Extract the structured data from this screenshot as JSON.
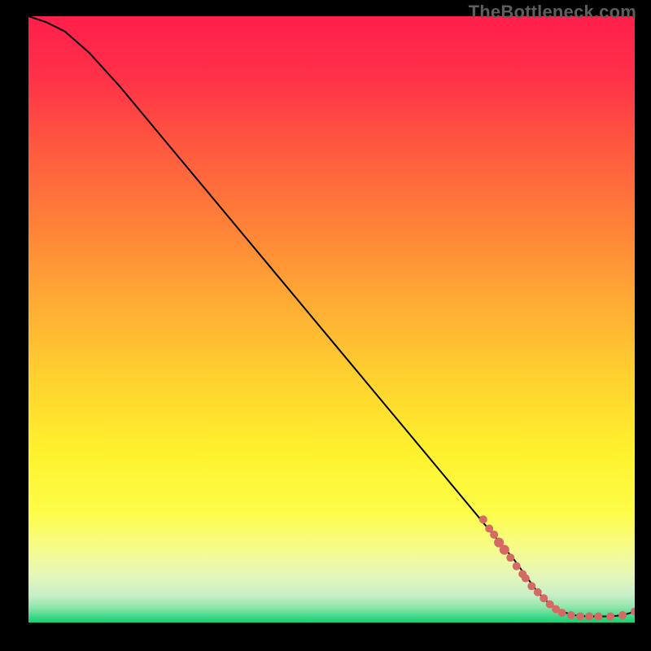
{
  "watermark": "TheBottleneck.com",
  "chart_data": {
    "type": "line",
    "title": "",
    "xlabel": "",
    "ylabel": "",
    "xlim": [
      0,
      100
    ],
    "ylim": [
      0,
      100
    ],
    "series": [
      {
        "name": "curve",
        "x": [
          0,
          3,
          6,
          10,
          15,
          20,
          25,
          30,
          35,
          40,
          45,
          50,
          55,
          60,
          65,
          70,
          75,
          80,
          84,
          86,
          88,
          90,
          92,
          94,
          96,
          98,
          100
        ],
        "y": [
          100,
          99,
          97.5,
          94,
          88.5,
          82.5,
          76.5,
          70.5,
          64.5,
          58.5,
          52.5,
          46.5,
          40.5,
          34.5,
          28.5,
          22.5,
          16.5,
          10.5,
          5,
          3,
          1.8,
          1.2,
          1.0,
          1.0,
          1.0,
          1.2,
          1.8
        ]
      }
    ],
    "markers": {
      "name": "highlighted-points",
      "color": "#d46a63",
      "points": [
        {
          "x": 75.0,
          "y": 17.0,
          "r": 5
        },
        {
          "x": 76.0,
          "y": 15.5,
          "r": 5
        },
        {
          "x": 76.8,
          "y": 14.5,
          "r": 5
        },
        {
          "x": 77.6,
          "y": 13.2,
          "r": 6
        },
        {
          "x": 78.5,
          "y": 12.0,
          "r": 6
        },
        {
          "x": 79.5,
          "y": 10.7,
          "r": 5
        },
        {
          "x": 80.5,
          "y": 9.3,
          "r": 5
        },
        {
          "x": 81.5,
          "y": 8.0,
          "r": 5
        },
        {
          "x": 82.0,
          "y": 7.3,
          "r": 5
        },
        {
          "x": 83.0,
          "y": 6.0,
          "r": 5
        },
        {
          "x": 84.0,
          "y": 5.0,
          "r": 5
        },
        {
          "x": 85.0,
          "y": 4.0,
          "r": 5
        },
        {
          "x": 86.0,
          "y": 3.0,
          "r": 5
        },
        {
          "x": 87.0,
          "y": 2.2,
          "r": 5
        },
        {
          "x": 88.0,
          "y": 1.6,
          "r": 5
        },
        {
          "x": 89.5,
          "y": 1.2,
          "r": 5
        },
        {
          "x": 91.0,
          "y": 1.0,
          "r": 5
        },
        {
          "x": 92.5,
          "y": 1.0,
          "r": 5
        },
        {
          "x": 94.0,
          "y": 1.0,
          "r": 5
        },
        {
          "x": 96.0,
          "y": 1.0,
          "r": 5
        },
        {
          "x": 98.0,
          "y": 1.2,
          "r": 5
        },
        {
          "x": 100.0,
          "y": 1.8,
          "r": 5
        }
      ]
    },
    "background_gradient_stops": [
      {
        "pos": 0.0,
        "color": "#ff1f4b"
      },
      {
        "pos": 0.1,
        "color": "#ff3148"
      },
      {
        "pos": 0.22,
        "color": "#ff5a3f"
      },
      {
        "pos": 0.35,
        "color": "#ff8338"
      },
      {
        "pos": 0.48,
        "color": "#ffae34"
      },
      {
        "pos": 0.6,
        "color": "#ffd22f"
      },
      {
        "pos": 0.72,
        "color": "#fff22d"
      },
      {
        "pos": 0.82,
        "color": "#fdfd4a"
      },
      {
        "pos": 0.88,
        "color": "#f6fb8e"
      },
      {
        "pos": 0.92,
        "color": "#e6f7b8"
      },
      {
        "pos": 0.955,
        "color": "#c8efc8"
      },
      {
        "pos": 0.975,
        "color": "#8fe6ab"
      },
      {
        "pos": 0.99,
        "color": "#3fd989"
      },
      {
        "pos": 1.0,
        "color": "#18cf72"
      }
    ]
  }
}
